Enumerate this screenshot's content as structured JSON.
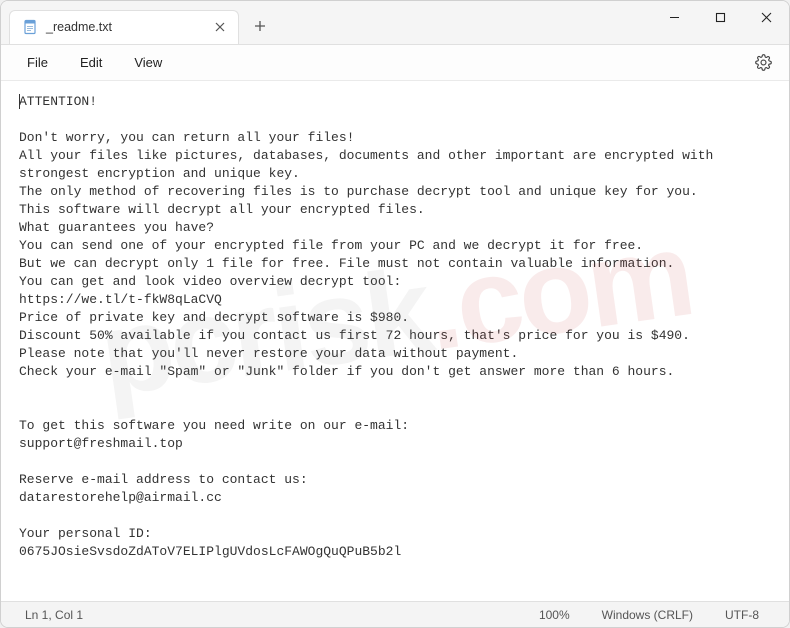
{
  "titlebar": {
    "tab": {
      "title": "_readme.txt"
    }
  },
  "menu": {
    "file": "File",
    "edit": "Edit",
    "view": "View"
  },
  "document": {
    "lines": [
      "ATTENTION!",
      "",
      "Don't worry, you can return all your files!",
      "All your files like pictures, databases, documents and other important are encrypted with strongest encryption and unique key.",
      "The only method of recovering files is to purchase decrypt tool and unique key for you.",
      "This software will decrypt all your encrypted files.",
      "What guarantees you have?",
      "You can send one of your encrypted file from your PC and we decrypt it for free.",
      "But we can decrypt only 1 file for free. File must not contain valuable information.",
      "You can get and look video overview decrypt tool:",
      "https://we.tl/t-fkW8qLaCVQ",
      "Price of private key and decrypt software is $980.",
      "Discount 50% available if you contact us first 72 hours, that's price for you is $490.",
      "Please note that you'll never restore your data without payment.",
      "Check your e-mail \"Spam\" or \"Junk\" folder if you don't get answer more than 6 hours.",
      "",
      "",
      "To get this software you need write on our e-mail:",
      "support@freshmail.top",
      "",
      "Reserve e-mail address to contact us:",
      "datarestorehelp@airmail.cc",
      "",
      "Your personal ID:",
      "0675JOsieSvsdoZdAToV7ELIPlgUVdosLcFAWOgQuQPuB5b2l"
    ]
  },
  "statusbar": {
    "position": "Ln 1, Col 1",
    "zoom": "100%",
    "lineending": "Windows (CRLF)",
    "encoding": "UTF-8"
  },
  "watermark": {
    "part1": "pcrisk",
    "part2": ".com"
  }
}
